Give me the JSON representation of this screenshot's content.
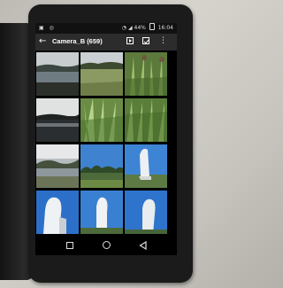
{
  "status_bar": {
    "left_icons": [
      "photo-icon",
      "whatsapp-icon"
    ],
    "battery": "44%",
    "time": "16:04"
  },
  "toolbar": {
    "title": "Camera_B (659)",
    "back_icon": "arrow-left-icon",
    "actions": [
      "slideshow-icon",
      "select-icon",
      "more-vert-icon"
    ]
  },
  "gallery": {
    "thumbnails": [
      "lake-landscape-dark",
      "field-with-tree-line",
      "sedge-grass-plants",
      "dark-lake-horizon",
      "green-reeds",
      "tall-grass-closeup",
      "lake-shore-with-hills",
      "trees-under-blue-sky",
      "white-sculpture-in-field",
      "white-bust-sculpture-blue-sky",
      "white-bust-sculpture-sky",
      "white-sculpture-profile"
    ]
  },
  "nav_bar": {
    "buttons": [
      "recents-square-icon",
      "home-circle-icon",
      "back-triangle-icon"
    ]
  },
  "colors": {
    "background": "#c9c6c0",
    "phone": "#1b1b1b",
    "toolbar": "#2c2c2c",
    "sky": "#3a7fd6"
  }
}
